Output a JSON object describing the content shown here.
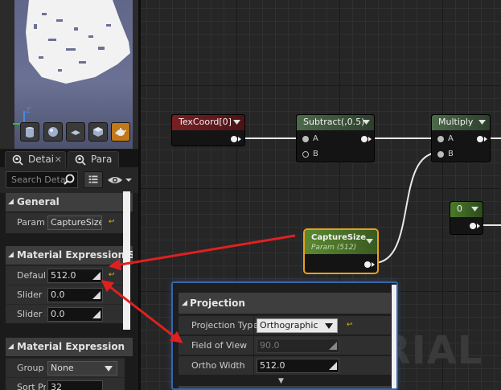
{
  "viewport": {
    "axis_label": "Z",
    "buttons": [
      "cylinder-icon",
      "sphere-icon",
      "plane-icon",
      "cube-icon",
      "teapot-icon"
    ],
    "active_button": "teapot-icon"
  },
  "tabs": [
    {
      "label": "Detai",
      "icon": "details-icon"
    },
    {
      "label": "Para",
      "icon": "parameters-icon"
    }
  ],
  "search": {
    "placeholder": "Search Deta"
  },
  "sections": {
    "general": {
      "title": "General",
      "param_label": "Param",
      "param_value": "CaptureSize"
    },
    "scalar": {
      "title": "Material Expression Sca",
      "default_label": "Default",
      "default_value": "512.0",
      "slider_min_label": "Slider I",
      "slider_min_value": "0.0",
      "slider_max_label": "Slider I",
      "slider_max_value": "0.0"
    },
    "expression": {
      "title": "Material Expression",
      "group_label": "Group",
      "group_value": "None",
      "sort_label": "Sort Pr",
      "sort_value": "32"
    }
  },
  "nodes": {
    "texcoord": {
      "title": "TexCoord[0]",
      "color": "#7a1f23"
    },
    "subtract": {
      "title": "Subtract(,0.5)",
      "color": "#4c6a4a",
      "in_a": "A",
      "in_b": "B"
    },
    "multiply": {
      "title": "Multiply",
      "color": "#4c6a4a",
      "in_a": "A",
      "in_b": "B"
    },
    "constant": {
      "title": "0",
      "color": "#4a7a2a"
    },
    "capture": {
      "title": "CaptureSize",
      "subtitle": "Param (512)",
      "color": "#5b8a32",
      "selected_color": "#e8a020"
    }
  },
  "watermark": "ERIAL",
  "projection": {
    "title": "Projection",
    "type_label": "Projection Type",
    "type_value": "Orthographic",
    "fov_label": "Field of View",
    "fov_value": "90.0",
    "ortho_label": "Ortho Width",
    "ortho_value": "512.0"
  },
  "colors": {
    "accent_orange": "#e8a020",
    "popup_border": "#3566a8",
    "annotation_arrow": "#e02020",
    "reset_yellow": "#e2c000"
  }
}
